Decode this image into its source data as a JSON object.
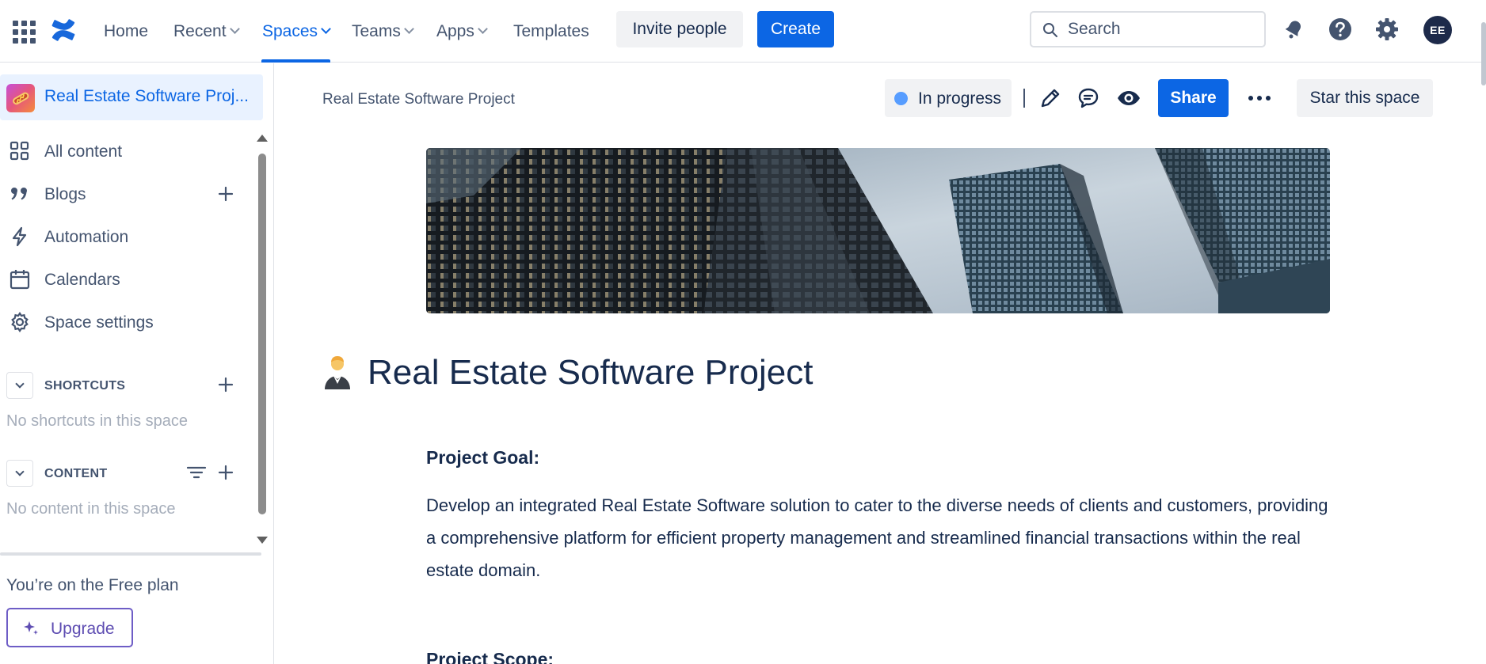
{
  "topnav": {
    "links": {
      "home": "Home",
      "recent": "Recent",
      "spaces": "Spaces",
      "teams": "Teams",
      "apps": "Apps",
      "templates": "Templates"
    },
    "invite_label": "Invite people",
    "create_label": "Create",
    "search": {
      "placeholder": "Search",
      "value": ""
    },
    "avatar_initials": "EE",
    "icons": [
      "app-switcher-icon",
      "confluence-logo-icon",
      "search-icon",
      "notifications-icon",
      "help-icon",
      "settings-icon"
    ]
  },
  "sidebar": {
    "space_name": "Real Estate Software Proj...",
    "items": {
      "all_content": "All content",
      "blogs": "Blogs",
      "automation": "Automation",
      "calendars": "Calendars",
      "space_settings": "Space settings"
    },
    "shortcuts": {
      "title": "SHORTCUTS",
      "empty": "No shortcuts in this space"
    },
    "content": {
      "title": "CONTENT",
      "empty": "No content in this space"
    },
    "plan_text": "You’re on the Free plan",
    "upgrade_label": "Upgrade"
  },
  "page": {
    "breadcrumb": "Real Estate Software Project",
    "status_label": "In progress",
    "share_label": "Share",
    "star_label": "Star this space",
    "title_emoji": "🤵",
    "title": "Real Estate Software Project",
    "goal_heading": "Project Goal:",
    "goal_text": "Develop an integrated Real Estate Software solution to cater to the diverse needs of clients and customers, providing a comprehensive platform for efficient property management and streamlined financial transactions within the real estate domain.",
    "scope_heading": "Project Scope:"
  },
  "colors": {
    "accent": "#0c66e4",
    "text": "#172b4d",
    "subtle_text": "#44546f",
    "status_dot": "#579dff",
    "upgrade": "#6e5dc6",
    "selected_bg": "#e9f2ff"
  }
}
